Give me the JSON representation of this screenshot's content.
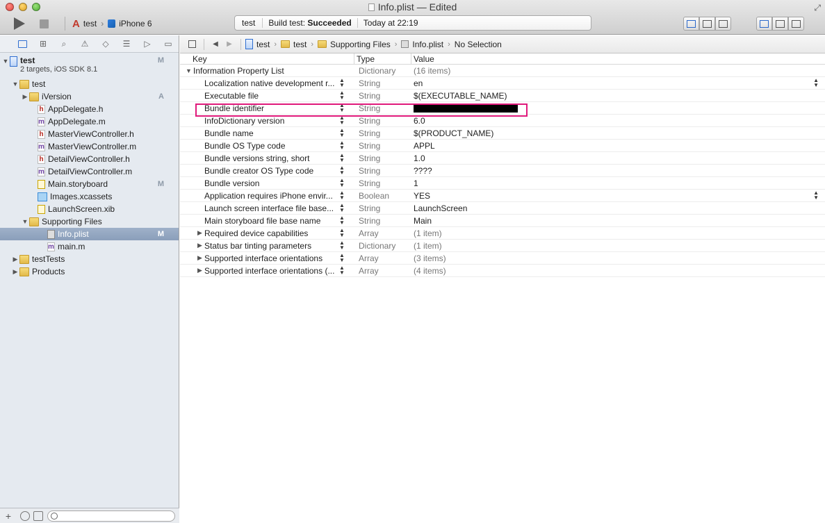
{
  "window": {
    "title": "Info.plist — Edited",
    "icons": {
      "close": "close-icon",
      "minimize": "minimize-icon",
      "zoom": "zoom-icon",
      "fullscreen": "fullscreen-arrows-icon"
    }
  },
  "toolbar": {
    "run_icon": "play-icon",
    "stop_icon": "stop-icon",
    "scheme_name": "test",
    "destination": "iPhone 6",
    "activity": {
      "scheme": "test",
      "status_prefix": "Build test:",
      "status_result": "Succeeded",
      "time": "Today at 22:19"
    },
    "editor_modes": [
      "standard-editor-icon",
      "assistant-editor-icon",
      "version-editor-icon"
    ],
    "view_toggles": [
      "navigator-toggle-icon",
      "debug-area-toggle-icon",
      "utilities-toggle-icon"
    ]
  },
  "navigator": {
    "tabs": [
      "folder-icon",
      "hierarchy-icon",
      "search-icon",
      "warning-icon",
      "test-diamond-icon",
      "debug-list-icon",
      "breakpoint-icon",
      "log-bubble-icon"
    ],
    "project": {
      "name": "test",
      "subtitle": "2 targets, iOS SDK 8.1",
      "badge": "M"
    },
    "items": [
      {
        "label": "test",
        "badge": ""
      },
      {
        "label": "iVersion",
        "badge": "A"
      },
      {
        "label": "AppDelegate.h",
        "badge": ""
      },
      {
        "label": "AppDelegate.m",
        "badge": ""
      },
      {
        "label": "MasterViewController.h",
        "badge": ""
      },
      {
        "label": "MasterViewController.m",
        "badge": ""
      },
      {
        "label": "DetailViewController.h",
        "badge": ""
      },
      {
        "label": "DetailViewController.m",
        "badge": ""
      },
      {
        "label": "Main.storyboard",
        "badge": "M"
      },
      {
        "label": "Images.xcassets",
        "badge": ""
      },
      {
        "label": "LaunchScreen.xib",
        "badge": ""
      },
      {
        "label": "Supporting Files",
        "badge": ""
      },
      {
        "label": "Info.plist",
        "badge": "M"
      },
      {
        "label": "main.m",
        "badge": ""
      },
      {
        "label": "testTests",
        "badge": ""
      },
      {
        "label": "Products",
        "badge": ""
      }
    ],
    "bottom": {
      "add": "+",
      "filter_placeholder": ""
    }
  },
  "jumpbar": {
    "crumbs": [
      "test",
      "test",
      "Supporting Files",
      "Info.plist",
      "No Selection"
    ]
  },
  "plist": {
    "headers": {
      "key": "Key",
      "type": "Type",
      "value": "Value"
    },
    "root": {
      "key": "Information Property List",
      "type": "Dictionary",
      "value": "(16 items)"
    },
    "rows": [
      {
        "key": "Localization native development r...",
        "type": "String",
        "value": "en"
      },
      {
        "key": "Executable file",
        "type": "String",
        "value": "$(EXECUTABLE_NAME)"
      },
      {
        "key": "Bundle identifier",
        "type": "String",
        "value": ""
      },
      {
        "key": "InfoDictionary version",
        "type": "String",
        "value": "6.0"
      },
      {
        "key": "Bundle name",
        "type": "String",
        "value": "$(PRODUCT_NAME)"
      },
      {
        "key": "Bundle OS Type code",
        "type": "String",
        "value": "APPL"
      },
      {
        "key": "Bundle versions string, short",
        "type": "String",
        "value": "1.0"
      },
      {
        "key": "Bundle creator OS Type code",
        "type": "String",
        "value": "????"
      },
      {
        "key": "Bundle version",
        "type": "String",
        "value": "1"
      },
      {
        "key": "Application requires iPhone envir...",
        "type": "Boolean",
        "value": "YES"
      },
      {
        "key": "Launch screen interface file base...",
        "type": "String",
        "value": "LaunchScreen"
      },
      {
        "key": "Main storyboard file base name",
        "type": "String",
        "value": "Main"
      },
      {
        "key": "Required device capabilities",
        "type": "Array",
        "value": "(1 item)"
      },
      {
        "key": "Status bar tinting parameters",
        "type": "Dictionary",
        "value": "(1 item)"
      },
      {
        "key": "Supported interface orientations",
        "type": "Array",
        "value": "(3 items)"
      },
      {
        "key": "Supported interface orientations (...",
        "type": "Array",
        "value": "(4 items)"
      }
    ],
    "highlight_color": "#e0197b"
  }
}
